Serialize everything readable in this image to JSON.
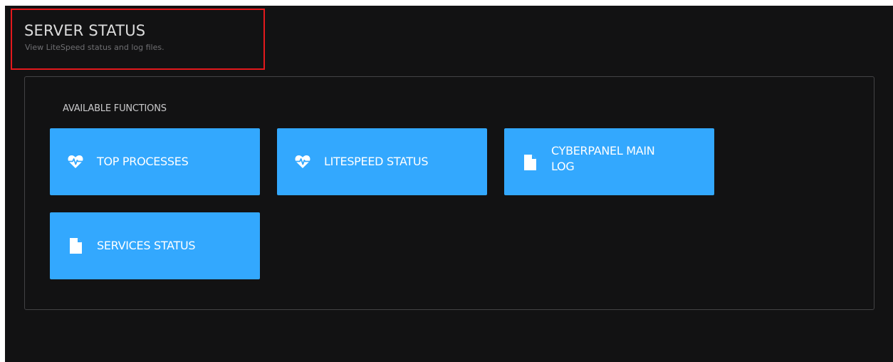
{
  "header": {
    "title": "SERVER STATUS",
    "subtitle": "View LiteSpeed status and log files."
  },
  "functions": {
    "section_label": "AVAILABLE FUNCTIONS",
    "items": [
      {
        "label": "TOP PROCESSES",
        "icon": "heartbeat-icon"
      },
      {
        "label": "LITESPEED STATUS",
        "icon": "heartbeat-icon"
      },
      {
        "label": "CYBERPANEL MAIN LOG",
        "icon": "file-icon"
      },
      {
        "label": "SERVICES STATUS",
        "icon": "file-icon"
      }
    ]
  },
  "colors": {
    "background": "#121213",
    "card": "#33a8fe",
    "highlight": "#e3191c",
    "panel_border": "#434345"
  }
}
